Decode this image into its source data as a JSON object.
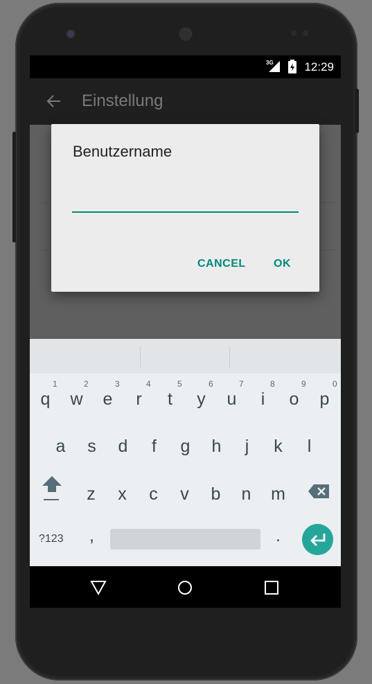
{
  "status_bar": {
    "network": "3G",
    "time": "12:29"
  },
  "app_bar": {
    "title": "Einstellung"
  },
  "dialog": {
    "title": "Benutzername",
    "input_value": "",
    "cancel_label": "CANCEL",
    "ok_label": "OK"
  },
  "keyboard": {
    "row1": [
      "q",
      "w",
      "e",
      "r",
      "t",
      "y",
      "u",
      "i",
      "o",
      "p"
    ],
    "row1_hints": [
      "1",
      "2",
      "3",
      "4",
      "5",
      "6",
      "7",
      "8",
      "9",
      "0"
    ],
    "row2": [
      "a",
      "s",
      "d",
      "f",
      "g",
      "h",
      "j",
      "k",
      "l"
    ],
    "row3": [
      "z",
      "x",
      "c",
      "v",
      "b",
      "n",
      "m"
    ],
    "symbols_label": "?123",
    "comma": ",",
    "period": ".",
    "accent_color": "#26a69a"
  },
  "nav_bar": {
    "icons": [
      "back-triangle-icon",
      "home-circle-icon",
      "recents-square-icon"
    ]
  }
}
